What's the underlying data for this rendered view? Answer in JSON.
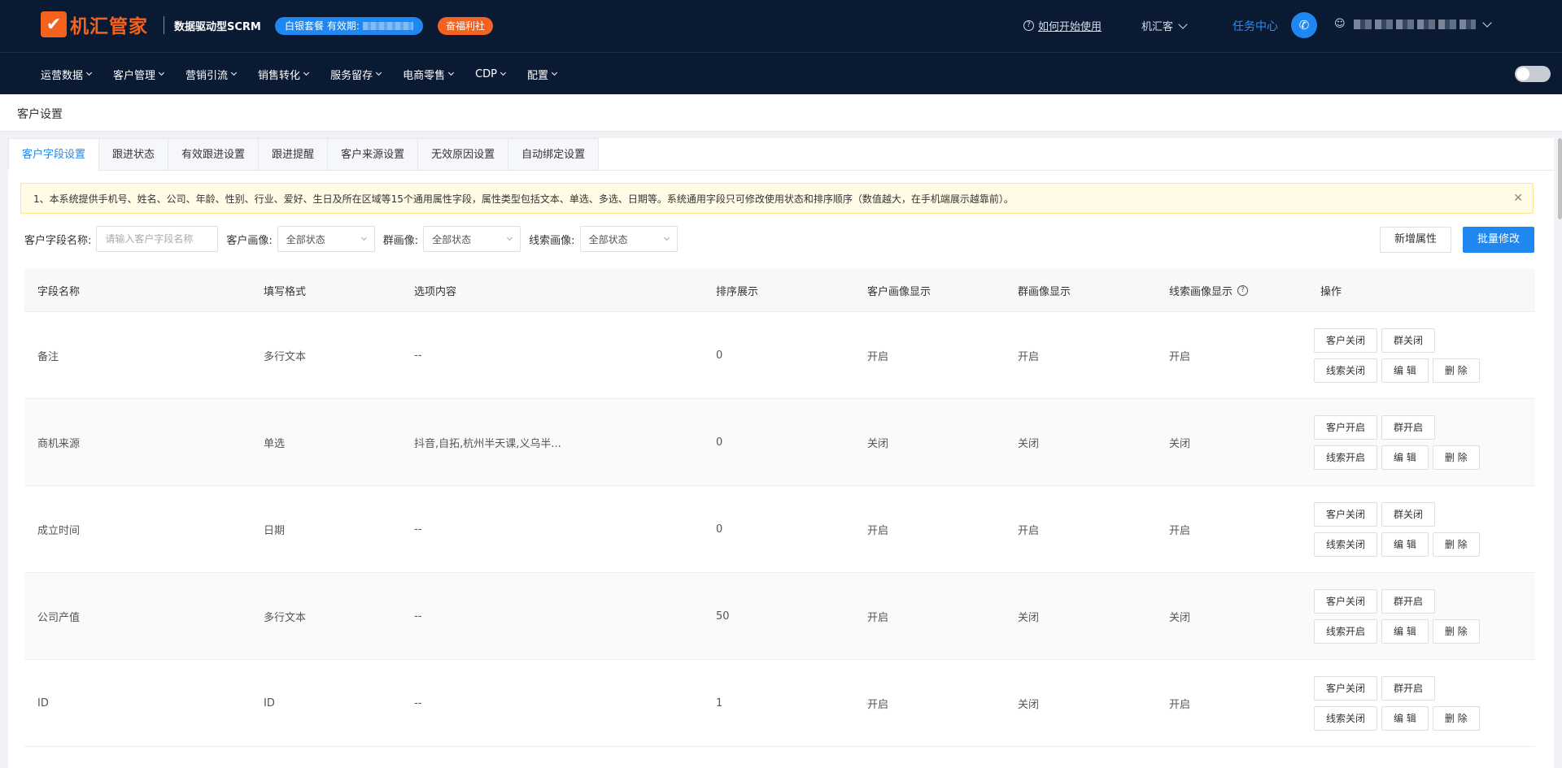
{
  "header": {
    "logo_mark": "✔",
    "logo_text": "机汇管家",
    "subtitle": "数据驱动型SCRM",
    "package_badge": "白银套餐 有效期:",
    "welfare_badge": "奋福利社",
    "help_link": "如何开始使用",
    "account_name": "机汇客",
    "task_center": "任务中心",
    "icons": [
      "help-circle-icon",
      "phone-icon",
      "user-icon",
      "chevron-down-icon"
    ]
  },
  "nav": {
    "items": [
      "运营数据",
      "客户管理",
      "营销引流",
      "销售转化",
      "服务留存",
      "电商零售",
      "CDP",
      "配置"
    ]
  },
  "breadcrumb": "客户设置",
  "tabs": [
    "客户字段设置",
    "跟进状态",
    "有效跟进设置",
    "跟进提醒",
    "客户来源设置",
    "无效原因设置",
    "自动绑定设置"
  ],
  "active_tab": "客户字段设置",
  "notice": "1、本系统提供手机号、姓名、公司、年龄、性别、行业、爱好、生日及所在区域等15个通用属性字段，属性类型包括文本、单选、多选、日期等。系统通用字段只可修改使用状态和排序顺序（数值越大，在手机端展示越靠前）。",
  "filters": {
    "name_label": "客户字段名称:",
    "name_placeholder": "请输入客户字段名称",
    "customer_label": "客户画像:",
    "customer_value": "全部状态",
    "group_label": "群画像:",
    "group_value": "全部状态",
    "lead_label": "线索画像:",
    "lead_value": "全部状态"
  },
  "actions": {
    "new": "新增属性",
    "batch": "批量修改"
  },
  "table": {
    "columns": [
      "字段名称",
      "填写格式",
      "选项内容",
      "排序展示",
      "客户画像显示",
      "群画像显示",
      "线索画像显示",
      "操作"
    ],
    "rows": [
      {
        "name": "备注",
        "format": "多行文本",
        "options": "--",
        "sort": "0",
        "customer": "开启",
        "group": "开启",
        "lead": "开启",
        "op_customer": "客户关闭",
        "op_group": "群关闭",
        "op_lead": "线索关闭",
        "op_edit": "编 辑",
        "op_delete": "删 除"
      },
      {
        "name": "商机来源",
        "format": "单选",
        "options": "抖音,自拓,杭州半天课,义乌半...",
        "sort": "0",
        "customer": "关闭",
        "group": "关闭",
        "lead": "关闭",
        "op_customer": "客户开启",
        "op_group": "群开启",
        "op_lead": "线索开启",
        "op_edit": "编 辑",
        "op_delete": "删 除"
      },
      {
        "name": "成立时间",
        "format": "日期",
        "options": "--",
        "sort": "0",
        "customer": "开启",
        "group": "开启",
        "lead": "开启",
        "op_customer": "客户关闭",
        "op_group": "群关闭",
        "op_lead": "线索关闭",
        "op_edit": "编 辑",
        "op_delete": "删 除"
      },
      {
        "name": "公司产值",
        "format": "多行文本",
        "options": "--",
        "sort": "50",
        "customer": "开启",
        "group": "关闭",
        "lead": "关闭",
        "op_customer": "客户关闭",
        "op_group": "群开启",
        "op_lead": "线索开启",
        "op_edit": "编 辑",
        "op_delete": "删 除"
      },
      {
        "name": "ID",
        "format": "ID",
        "options": "--",
        "sort": "1",
        "customer": "开启",
        "group": "关闭",
        "lead": "开启",
        "op_customer": "客户关闭",
        "op_group": "群开启",
        "op_lead": "线索关闭",
        "op_edit": "编 辑",
        "op_delete": "删 除"
      }
    ]
  },
  "colors": {
    "topbar_bg": "#0b1a33",
    "brand_orange": "#f4621f",
    "primary_blue": "#1e88f0"
  }
}
